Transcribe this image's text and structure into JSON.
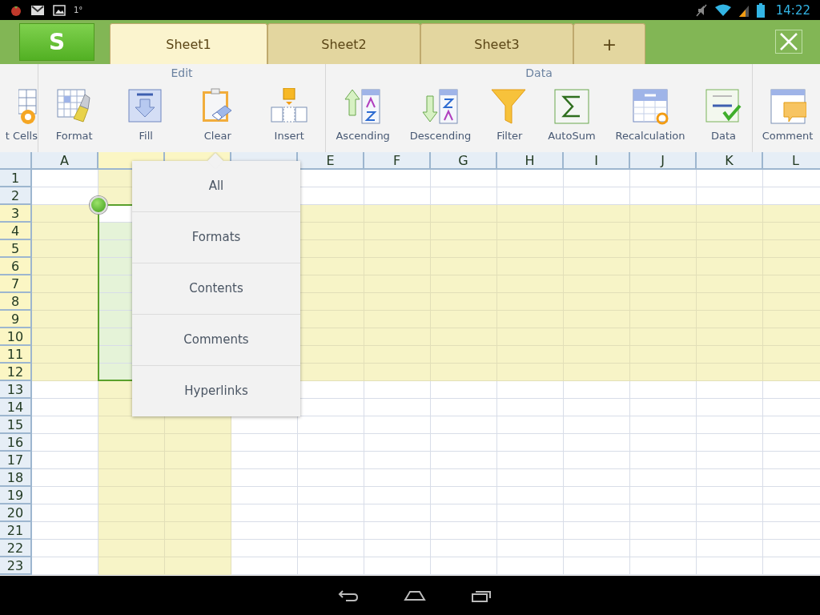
{
  "status_bar": {
    "notification_text": "1°",
    "time": "14:22"
  },
  "app_logo": {
    "label": "S"
  },
  "tabs": [
    {
      "label": "Sheet1",
      "selected": true
    },
    {
      "label": "Sheet2",
      "selected": false
    },
    {
      "label": "Sheet3",
      "selected": false
    }
  ],
  "add_tab": {
    "label": "+"
  },
  "ribbon": {
    "groups": [
      {
        "kind": "partial",
        "tools": [
          {
            "label": "t Cells",
            "kind": "cells"
          }
        ]
      },
      {
        "kind": "full",
        "title": "Edit",
        "tools": [
          {
            "label": "Format",
            "kind": "format"
          },
          {
            "label": "Fill",
            "kind": "fill"
          },
          {
            "label": "Clear",
            "kind": "clear"
          },
          {
            "label": "Insert",
            "kind": "insert"
          }
        ]
      },
      {
        "kind": "full",
        "title": "Data",
        "tools": [
          {
            "label": "Ascending",
            "kind": "ascending"
          },
          {
            "label": "Descending",
            "kind": "descending"
          },
          {
            "label": "Filter",
            "kind": "filter"
          },
          {
            "label": "AutoSum",
            "kind": "autosum"
          },
          {
            "label": "Recalculation",
            "kind": "recalc"
          },
          {
            "label": "Data",
            "kind": "data"
          }
        ]
      },
      {
        "kind": "partial",
        "tools": [
          {
            "label": "Comment",
            "kind": "comment"
          }
        ]
      }
    ]
  },
  "sheet": {
    "columns": [
      {
        "label": "A",
        "selected": false
      },
      {
        "selected": true
      },
      {
        "selected": true
      },
      {
        "selected": false
      },
      {
        "label": "E",
        "selected": false
      },
      {
        "label": "F",
        "selected": false
      },
      {
        "label": "G",
        "selected": false
      },
      {
        "label": "H",
        "selected": false
      },
      {
        "label": "I",
        "selected": false
      },
      {
        "label": "J",
        "selected": false
      },
      {
        "label": "K",
        "selected": false
      },
      {
        "label": "L",
        "selected": false
      }
    ],
    "rows": [
      {
        "label": "1",
        "selected": false
      },
      {
        "label": "2",
        "selected": false
      },
      {
        "label": "3",
        "selected": true
      },
      {
        "label": "4",
        "selected": true
      },
      {
        "label": "5",
        "selected": true
      },
      {
        "label": "6",
        "selected": true
      },
      {
        "label": "7",
        "selected": true
      },
      {
        "label": "8",
        "selected": true
      },
      {
        "label": "9",
        "selected": true
      },
      {
        "label": "10",
        "selected": true
      },
      {
        "label": "11",
        "selected": true
      },
      {
        "label": "12",
        "selected": true
      },
      {
        "label": "13",
        "selected": false
      },
      {
        "label": "14",
        "selected": false
      },
      {
        "label": "15",
        "selected": false
      },
      {
        "label": "16",
        "selected": false
      },
      {
        "label": "17",
        "selected": false
      },
      {
        "label": "18",
        "selected": false
      },
      {
        "label": "19",
        "selected": false
      },
      {
        "label": "20",
        "selected": false
      },
      {
        "label": "21",
        "selected": false
      },
      {
        "label": "22",
        "selected": false
      },
      {
        "label": "23",
        "selected": false
      }
    ]
  },
  "clear_menu": {
    "items": [
      "All",
      "Formats",
      "Contents",
      "Comments",
      "Hyperlinks"
    ]
  }
}
